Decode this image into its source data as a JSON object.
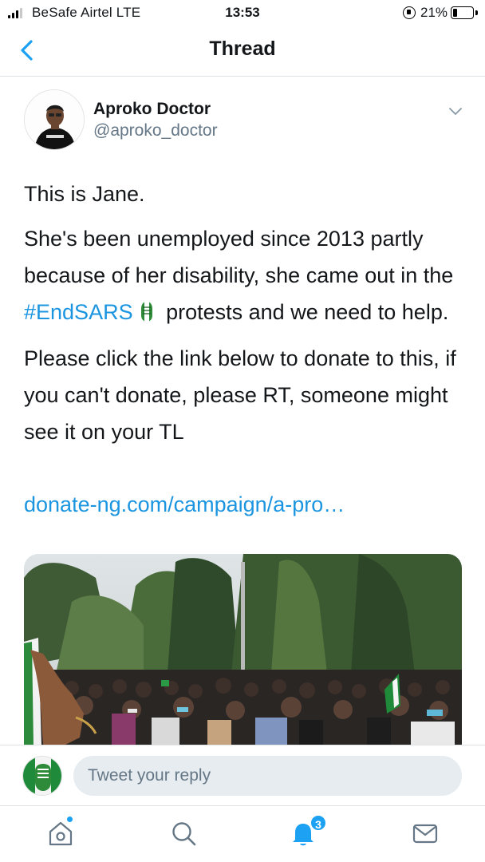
{
  "status_bar": {
    "carrier": "BeSafe Airtel  LTE",
    "time": "13:53",
    "battery_percent": "21%",
    "battery_level": 0.21
  },
  "nav": {
    "title": "Thread",
    "back_icon": "chevron-left-icon"
  },
  "tweet": {
    "author_name": "Aproko Doctor",
    "author_handle": "@aproko_doctor",
    "text_line_1": "This is Jane.",
    "text_para_2_before": "She's been unemployed since 2013 partly because of her disability, she came out in the ",
    "hashtag": "#EndSARS",
    "emoji": "raised-fist-nigeria-icon",
    "text_para_2_after": " protests and we need to help.",
    "text_para_3": "Please click the link below to donate to this, if you can't donate, please RT, someone might see it on your TL",
    "link": "donate-ng.com/campaign/a-pro…",
    "media_icon": "protest-crowd-photo"
  },
  "reply": {
    "placeholder": "Tweet your reply"
  },
  "tab_bar": {
    "notifications_count": "3",
    "icons": [
      "home-icon",
      "search-icon",
      "bell-icon",
      "mail-icon"
    ]
  },
  "colors": {
    "link_blue": "#1b95e0",
    "twitter_blue": "#1da1f2",
    "text_primary": "#14171a",
    "text_secondary": "#657786"
  }
}
